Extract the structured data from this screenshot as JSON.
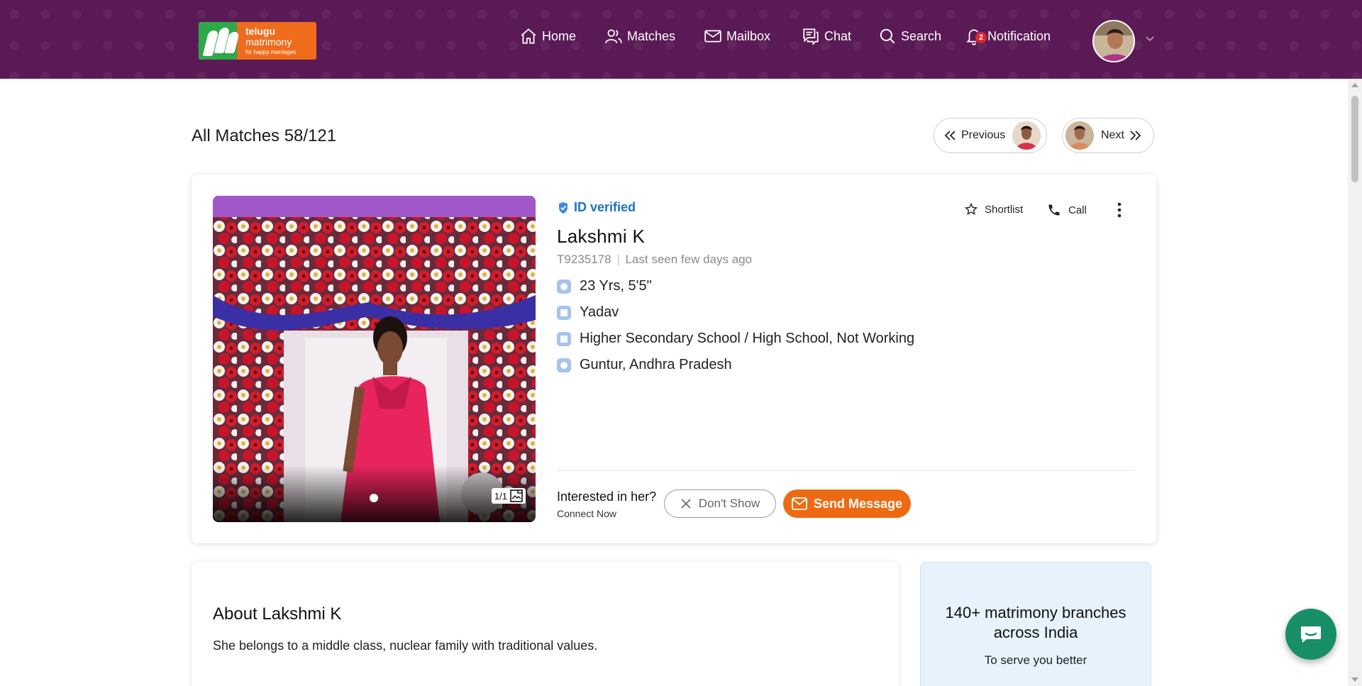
{
  "logo": {
    "line1": "telugu",
    "line2": "matrimony",
    "tagline": "for happy marriages"
  },
  "nav": {
    "home": "Home",
    "matches": "Matches",
    "mailbox": "Mailbox",
    "chat": "Chat",
    "search": "Search",
    "notification": "Notification",
    "notification_count": "2"
  },
  "page": {
    "title": "All Matches 58/121",
    "previous": "Previous",
    "next": "Next"
  },
  "profile": {
    "verified": "ID verified",
    "name": "Lakshmi K",
    "id": "T9235178",
    "separator": "|",
    "last_seen": "Last seen few days ago",
    "age_height": "23 Yrs, 5'5\"",
    "caste": "Yadav",
    "education": "Higher Secondary School / High School, Not Working",
    "location": "Guntur, Andhra Pradesh",
    "photo_count": "1/1",
    "shortlist": "Shortlist",
    "call": "Call",
    "interested": "Interested in her?",
    "connect": "Connect Now",
    "dont_show": "Don't Show",
    "send_message": "Send Message"
  },
  "about": {
    "title": "About Lakshmi K",
    "text": "She belongs to a middle class, nuclear family with traditional values."
  },
  "branches": {
    "title": "140+ matrimony branches across India",
    "subtitle": "To serve you better"
  },
  "colors": {
    "header": "#5a1a55",
    "brand_orange": "#ee6a12",
    "verified_blue": "#1a73c8",
    "chat_green": "#178e67"
  }
}
